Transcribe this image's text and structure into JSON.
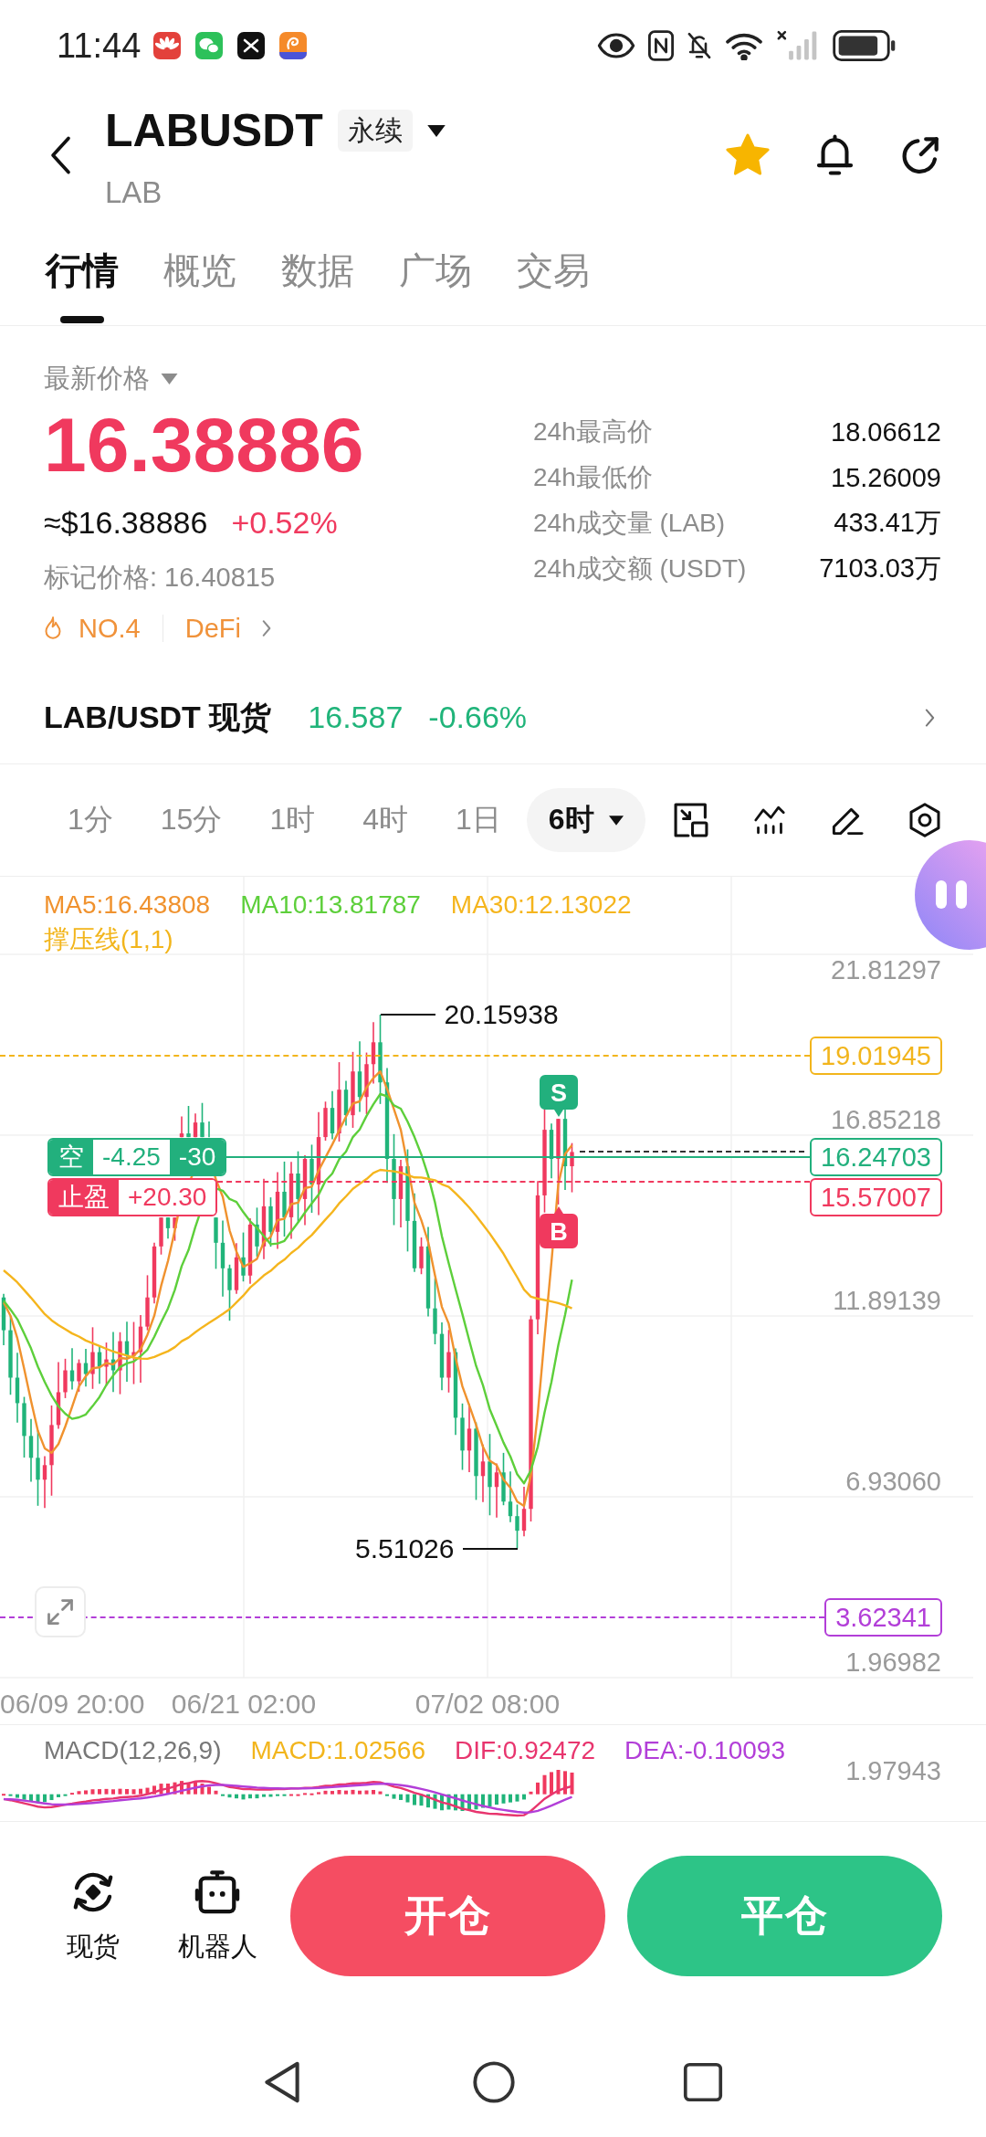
{
  "status_bar": {
    "time": "11:44"
  },
  "header": {
    "symbol": "LABUSDT",
    "contract": "永续",
    "base": "LAB",
    "favorited": true
  },
  "tabs": [
    {
      "label": "行情",
      "selected": true
    },
    {
      "label": "概览",
      "selected": false
    },
    {
      "label": "数据",
      "selected": false
    },
    {
      "label": "广场",
      "selected": false
    },
    {
      "label": "交易",
      "selected": false
    }
  ],
  "price": {
    "label": "最新价格",
    "last": "16.38886",
    "usd": "≈$16.38886",
    "change": "+0.52%",
    "mark": "标记价格: 16.40815",
    "rank": "NO.4",
    "sector": "DeFi"
  },
  "stats": [
    {
      "label": "24h最高价",
      "value": "18.06612"
    },
    {
      "label": "24h最低价",
      "value": "15.26009"
    },
    {
      "label": "24h成交量 (LAB)",
      "value": "433.41万"
    },
    {
      "label": "24h成交额 (USDT)",
      "value": "7103.03万"
    }
  ],
  "spot": {
    "pair": "LAB/USDT 现货",
    "price": "16.587",
    "change": "-0.66%"
  },
  "intervals": [
    {
      "label": "1分",
      "selected": false
    },
    {
      "label": "15分",
      "selected": false
    },
    {
      "label": "1时",
      "selected": false
    },
    {
      "label": "4时",
      "selected": false
    },
    {
      "label": "1日",
      "selected": false
    },
    {
      "label": "6时",
      "selected": true
    }
  ],
  "chart": {
    "legend": [
      {
        "text": "MA5:16.43808",
        "color": "#f0922e"
      },
      {
        "text": "MA10:13.81787",
        "color": "#5dcf3b"
      },
      {
        "text": "MA30:12.13022",
        "color": "#f5b51d"
      }
    ],
    "indicator": "撑压线(1,1)",
    "y_labels": [
      "21.81297",
      "16.85218",
      "11.89139",
      "6.93060",
      "1.96982"
    ],
    "x_labels": [
      "06/09 20:00",
      "06/21 02:00",
      "07/02 08:00"
    ],
    "high_marker": "20.15938",
    "low_marker": "5.51026",
    "lines": [
      {
        "kind": "resistance",
        "price": "19.01945"
      },
      {
        "kind": "position",
        "price": "16.24703",
        "tag": "空",
        "pnl": "-4.25",
        "amount": "-30"
      },
      {
        "kind": "take_profit",
        "price": "15.57007",
        "tag": "止盈",
        "pnl": "+20.30"
      },
      {
        "kind": "support",
        "price": "3.62341"
      }
    ],
    "signals": [
      {
        "kind": "sell",
        "label": "S"
      },
      {
        "kind": "buy",
        "label": "B"
      }
    ]
  },
  "macd": {
    "title": "MACD(12,26,9)",
    "values": [
      {
        "text": "MACD:1.02566",
        "color": "#f2b51c"
      },
      {
        "text": "DIF:0.92472",
        "color": "#e8356e"
      },
      {
        "text": "DEA:-0.10093",
        "color": "#b23ed8"
      }
    ],
    "y_label": "1.97943"
  },
  "bottom_bar": {
    "shortcuts": [
      {
        "kind": "spot",
        "label": "现货"
      },
      {
        "kind": "robot",
        "label": "机器人"
      }
    ],
    "actions": [
      {
        "kind": "open",
        "label": "开仓"
      },
      {
        "kind": "close",
        "label": "平仓"
      }
    ]
  }
}
